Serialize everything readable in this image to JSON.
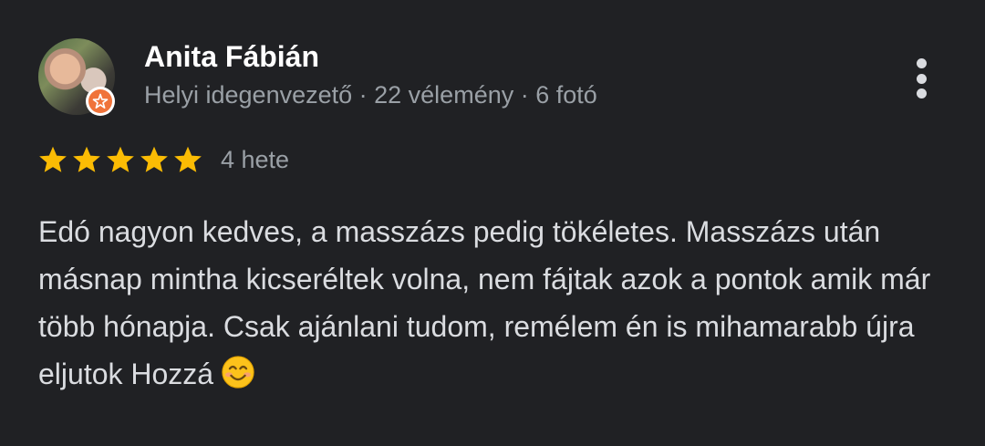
{
  "review": {
    "author_name": "Anita Fábián",
    "author_meta": "Helyi idegenvezető · 22 vélemény · 6 fotó",
    "avatar_icon": "user-photo-avatar",
    "badge_icon": "local-guide-star-icon",
    "rating": 5,
    "rating_max": 5,
    "star_color": "#fbbc04",
    "time_ago": "4 hete",
    "body_text": "Edó nagyon kedves, a masszázs pedig tökéletes. Masszázs után másnap mintha kicseréltek volna, nem fájtak azok a pontok amik már több hónapja. Csak ajánlani tudom, remélem én is mihamarabb újra eljutok Hozzá",
    "trailing_emoji_icon": "smiling-face-emoji",
    "more_icon": "more-vert-icon"
  },
  "colors": {
    "background": "#202124",
    "name": "#ffffff",
    "secondary_text": "#9aa0a6",
    "body_text": "#dadce0",
    "badge": "#f0733a"
  }
}
